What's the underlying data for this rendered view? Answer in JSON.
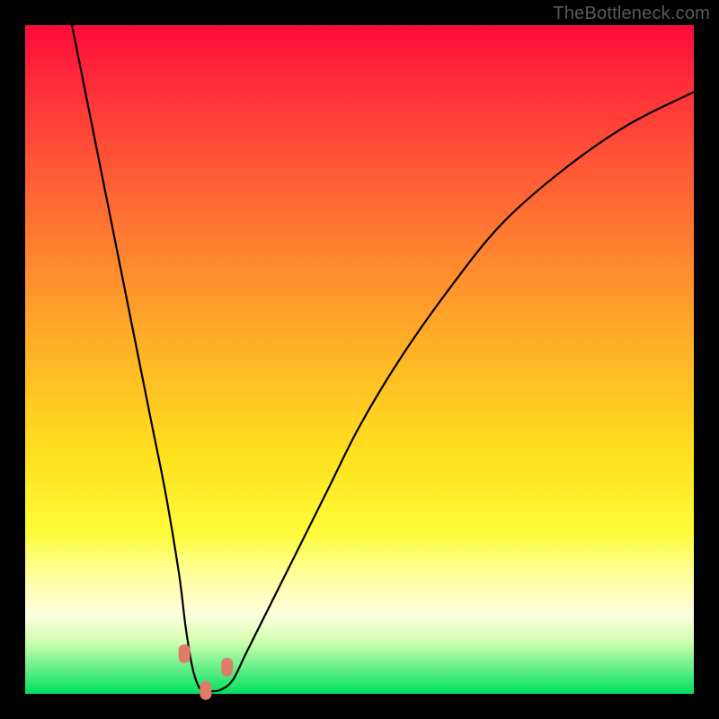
{
  "attribution": "TheBottleneck.com",
  "chart_data": {
    "type": "line",
    "title": "",
    "xlabel": "",
    "ylabel": "",
    "xlim": [
      0,
      100
    ],
    "ylim": [
      0,
      100
    ],
    "series": [
      {
        "name": "bottleneck-curve",
        "x": [
          7,
          9,
          11,
          13,
          15,
          17,
          19,
          21,
          23,
          24,
          25,
          26,
          27,
          29,
          31,
          33,
          36,
          40,
          45,
          50,
          56,
          63,
          71,
          80,
          90,
          100
        ],
        "y": [
          100,
          90,
          80,
          70,
          60,
          50,
          40,
          30,
          18,
          10,
          4,
          1,
          0.5,
          0.5,
          2,
          6,
          12,
          20,
          30,
          40,
          50,
          60,
          70,
          78,
          85,
          90
        ]
      }
    ],
    "markers": [
      {
        "name": "left-marker",
        "x": 23.8,
        "y": 6
      },
      {
        "name": "right-marker",
        "x": 30.2,
        "y": 4
      },
      {
        "name": "bottom-marker",
        "x": 27.0,
        "y": 0.5
      }
    ],
    "colors": {
      "gradient_top": "#ff0a3a",
      "gradient_mid": "#ffe01e",
      "gradient_bottom": "#00e060",
      "curve": "#000000",
      "marker": "#e07a6a"
    }
  }
}
